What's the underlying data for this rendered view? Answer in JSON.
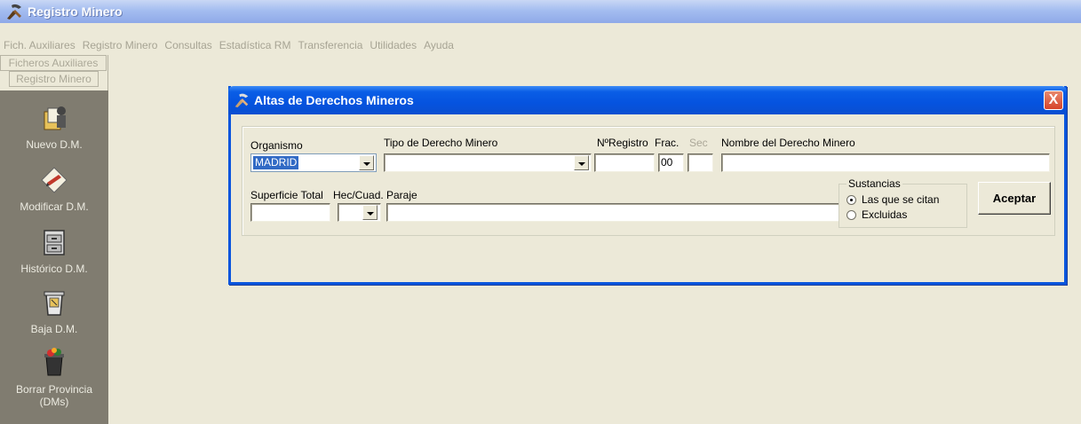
{
  "app": {
    "title": "Registro Minero"
  },
  "menu": [
    "Fich. Auxiliares",
    "Registro Minero",
    "Consultas",
    "Estadística RM",
    "Transferencia",
    "Utilidades",
    "Ayuda"
  ],
  "sidebar": {
    "headers": [
      "Ficheros Auxiliares",
      "Registro Minero"
    ],
    "tools": [
      {
        "label": "Nuevo D.M.",
        "icon": "new-document-icon"
      },
      {
        "label": "Modificar D.M.",
        "icon": "edit-document-icon"
      },
      {
        "label": "Histórico D.M.",
        "icon": "archive-cabinet-icon"
      },
      {
        "label": "Baja D.M.",
        "icon": "trash-bin-icon"
      },
      {
        "label_line1": "Borrar Provincia",
        "label_line2": "(DMs)",
        "icon": "delete-province-icon"
      }
    ]
  },
  "dialog": {
    "title": "Altas de Derechos Mineros",
    "close": "X",
    "labels": {
      "organismo": "Organismo",
      "tipo": "Tipo de Derecho Minero",
      "nregistro": "NºRegistro",
      "frac": "Frac.",
      "sec": "Sec",
      "nombre": "Nombre del Derecho Minero",
      "superficie": "Superficie Total",
      "heccuad": "Hec/Cuad.",
      "paraje": "Paraje"
    },
    "values": {
      "organismo": "MADRID",
      "tipo": "",
      "nregistro": "",
      "frac": "00",
      "sec": "",
      "nombre": "",
      "superficie": "",
      "heccuad": "",
      "paraje": ""
    },
    "sustancias": {
      "legend": "Sustancias",
      "options": [
        "Las que se citan",
        "Excluidas"
      ],
      "selected": "Las que se citan"
    },
    "accept": "Aceptar"
  },
  "colors": {
    "titlebar": "#0553df",
    "sidebar_panel": "#807c70",
    "background": "#ece9d8",
    "selection": "#316ac5"
  }
}
